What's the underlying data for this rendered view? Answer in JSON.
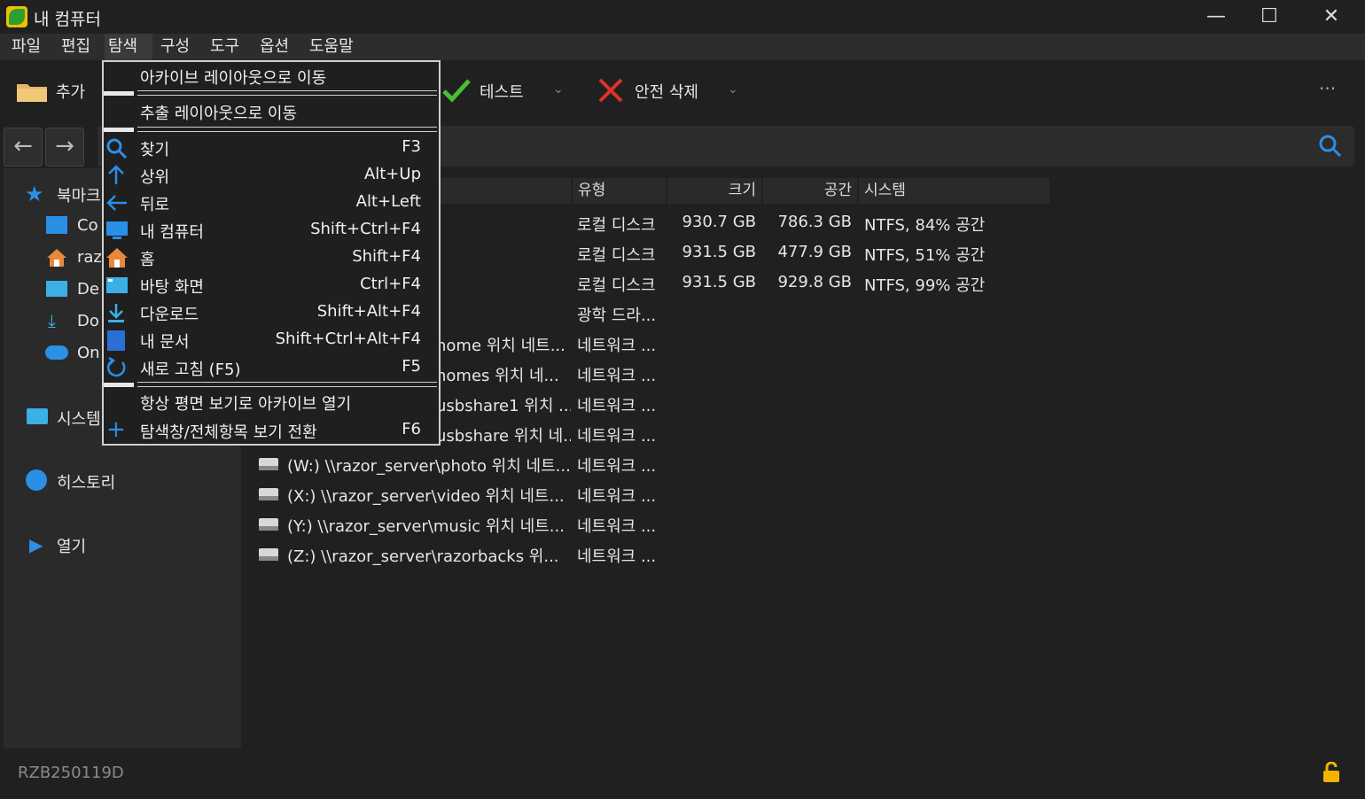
{
  "window": {
    "title": "내 컴퓨터",
    "minimize": "—",
    "maximize": "☐",
    "close": "✕"
  },
  "menubar": [
    "파일",
    "편집",
    "탐색",
    "구성",
    "도구",
    "옵션",
    "도움말"
  ],
  "toolbar": {
    "add": "추가",
    "test": "테스트",
    "safe_delete": "안전 삭제",
    "more": "···"
  },
  "nav": {
    "back": "←",
    "forward": "→"
  },
  "sidebar": {
    "bookmarks": "북마크",
    "items": [
      "Co",
      "raz",
      "De",
      "Do",
      "On"
    ],
    "system": "시스템",
    "history": "히스토리",
    "open": "열기"
  },
  "columns": {
    "type": "유형",
    "size": "크기",
    "free": "공간",
    "fs": "시스템"
  },
  "rows": [
    {
      "name": "",
      "type": "로컬 디스크",
      "size": "930.7 GB",
      "free": "786.3 GB",
      "fs": "NTFS, 84% 공간"
    },
    {
      "name": "",
      "type": "로컬 디스크",
      "size": "931.5 GB",
      "free": "477.9 GB",
      "fs": "NTFS, 51% 공간"
    },
    {
      "name": "",
      "type": "로컬 디스크",
      "size": "931.5 GB",
      "free": "929.8 GB",
      "fs": "NTFS, 99% 공간"
    },
    {
      "name": "",
      "type": "광학 드라...",
      "size": "",
      "free": "",
      "fs": ""
    },
    {
      "name": "home 위치 네트...",
      "type": "네트워크 ...",
      "size": "",
      "free": "",
      "fs": ""
    },
    {
      "name": "homes 위치 네...",
      "type": "네트워크 ...",
      "size": "",
      "free": "",
      "fs": ""
    },
    {
      "name": "usbshare1 위치 ...",
      "type": "네트워크 ...",
      "size": "",
      "free": "",
      "fs": ""
    },
    {
      "name": "usbshare 위치 네...",
      "type": "네트워크 ...",
      "size": "",
      "free": "",
      "fs": ""
    },
    {
      "name": "(W:) \\\\razor_server\\photo 위치 네트...",
      "type": "네트워크 ...",
      "size": "",
      "free": "",
      "fs": ""
    },
    {
      "name": "(X:) \\\\razor_server\\video 위치 네트...",
      "type": "네트워크 ...",
      "size": "",
      "free": "",
      "fs": ""
    },
    {
      "name": "(Y:) \\\\razor_server\\music 위치 네트...",
      "type": "네트워크 ...",
      "size": "",
      "free": "",
      "fs": ""
    },
    {
      "name": "(Z:) \\\\razor_server\\razorbacks 위...",
      "type": "네트워크 ...",
      "size": "",
      "free": "",
      "fs": ""
    }
  ],
  "menu": {
    "archive_layout": "아카이브 레이아웃으로 이동",
    "extract_layout": "추출 레이아웃으로 이동",
    "items": [
      {
        "label": "찾기",
        "shortcut": "F3",
        "icon": "search-icon"
      },
      {
        "label": "상위",
        "shortcut": "Alt+Up",
        "icon": "arrow-up-icon"
      },
      {
        "label": "뒤로",
        "shortcut": "Alt+Left",
        "icon": "arrow-left-icon"
      },
      {
        "label": "내 컴퓨터",
        "shortcut": "Shift+Ctrl+F4",
        "icon": "computer-icon"
      },
      {
        "label": "홈",
        "shortcut": "Shift+F4",
        "icon": "home-icon"
      },
      {
        "label": "바탕 화면",
        "shortcut": "Ctrl+F4",
        "icon": "desktop-icon"
      },
      {
        "label": "다운로드",
        "shortcut": "Shift+Alt+F4",
        "icon": "download-icon"
      },
      {
        "label": "내 문서",
        "shortcut": "Shift+Ctrl+Alt+F4",
        "icon": "documents-icon"
      },
      {
        "label": "새로 고침 (F5)",
        "shortcut": "F5",
        "icon": "refresh-icon"
      }
    ],
    "flat_view": "항상 평면 보기로 아카이브 열기",
    "toggle_view": {
      "label": "탐색창/전체항목 보기 전환",
      "shortcut": "F6"
    }
  },
  "status": {
    "text": "RZB250119D"
  }
}
